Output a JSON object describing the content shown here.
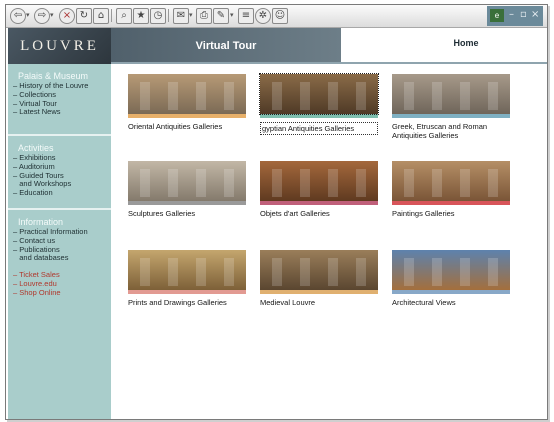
{
  "toolbar": {
    "icons": [
      "back-icon",
      "forward-icon",
      "stop-icon",
      "refresh-icon",
      "home-icon",
      "search-icon",
      "favorites-icon",
      "history-icon",
      "mail-icon",
      "print-icon",
      "edit-icon",
      "discuss-icon",
      "messenger-icon",
      "user-icon"
    ]
  },
  "window_controls": {
    "minimize": "–",
    "maximize": "▫",
    "close": "×"
  },
  "header": {
    "logo": "LOUVRE",
    "title": "Virtual Tour",
    "home": "Home"
  },
  "sidebar": {
    "sections": [
      {
        "heading": "Palais & Museum",
        "items": [
          "– History of the Louvre",
          "– Collections",
          "– Virtual Tour",
          "– Latest News"
        ]
      },
      {
        "heading": "Activities",
        "items": [
          "– Exhibitions",
          "– Auditorium",
          "– Guided Tours\n   and Workshops",
          "– Education"
        ]
      },
      {
        "heading": "Information",
        "items": [
          "– Practical Information",
          "– Contact us",
          "– Publications\n   and databases"
        ],
        "links": [
          "– Ticket Sales",
          "– Louvre.edu",
          "– Shop Online"
        ]
      }
    ]
  },
  "galleries": [
    {
      "caption": "Oriental Antiquities Galleries",
      "stripe": "#e7b06a",
      "tone": [
        "#b79a76",
        "#7b6a55"
      ]
    },
    {
      "caption": "gyptian Antiquities Galleries",
      "stripe": "#7fbfae",
      "tone": [
        "#8a6b48",
        "#4f3a26"
      ]
    },
    {
      "caption": "Greek, Etruscan and Roman\nAntiquities Galleries",
      "stripe": "#7fb0c2",
      "tone": [
        "#a79a8a",
        "#6f655a"
      ]
    },
    {
      "caption": "Sculptures Galleries",
      "stripe": "#9a9a9a",
      "tone": [
        "#c2b7a6",
        "#847a6c"
      ]
    },
    {
      "caption": "Objets d'art Galleries",
      "stripe": "#c0607a",
      "tone": [
        "#a4683c",
        "#5f3a20"
      ]
    },
    {
      "caption": "Paintings Galleries",
      "stripe": "#d8555a",
      "tone": [
        "#b58f66",
        "#7a5537"
      ]
    },
    {
      "caption": "Prints and Drawings Galleries",
      "stripe": "#e29a92",
      "tone": [
        "#c4a66e",
        "#7d6038"
      ]
    },
    {
      "caption": "Medieval Louvre",
      "stripe": "#e0b070",
      "tone": [
        "#9a7e5a",
        "#5a4630"
      ]
    },
    {
      "caption": "Architectural Views",
      "stripe": "#88a8c8",
      "tone": [
        "#5d82ad",
        "#a46f3c"
      ]
    }
  ]
}
